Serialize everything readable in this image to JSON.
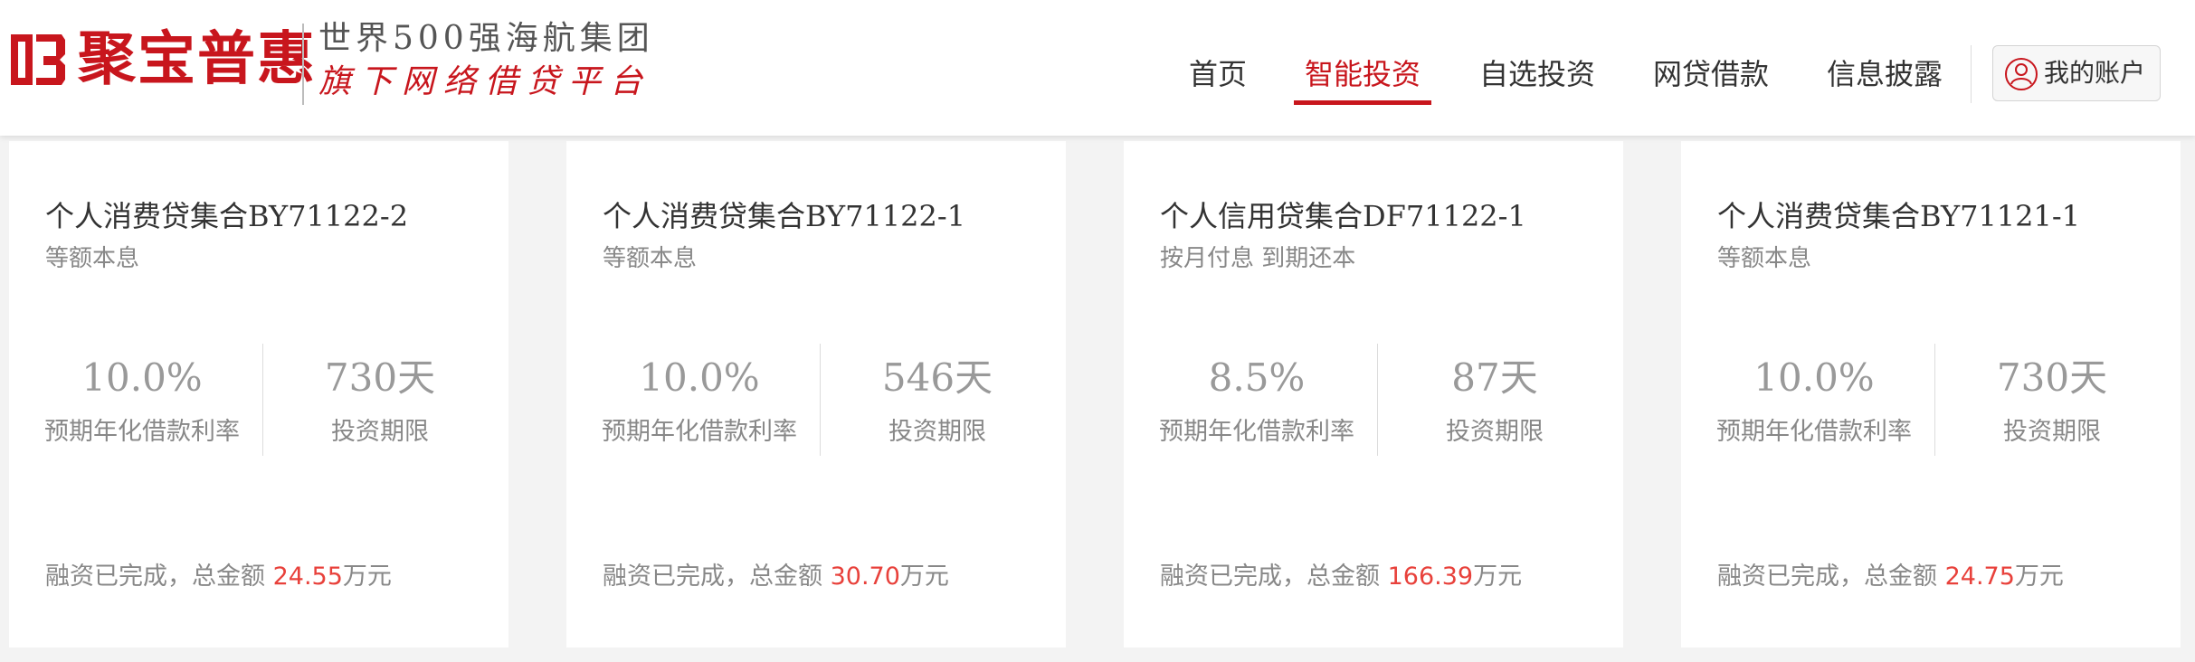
{
  "brand": {
    "name": "聚宝普惠",
    "slogan_line1": "世界500强海航集团",
    "slogan_line2": "旗下网络借贷平台",
    "color": "#c8161d"
  },
  "nav": {
    "items": [
      {
        "label": "首页"
      },
      {
        "label": "智能投资",
        "active": true
      },
      {
        "label": "自选投资"
      },
      {
        "label": "网贷借款"
      },
      {
        "label": "信息披露"
      }
    ],
    "account": {
      "label": "我的账户",
      "icon": "user-icon"
    }
  },
  "cards": [
    {
      "title": "个人消费贷集合BY71122-2",
      "repayment": "等额本息",
      "rate": "10.0%",
      "rate_label": "预期年化借款利率",
      "term": "730天",
      "term_label": "投资期限",
      "footer_prefix": "融资已完成，总金额 ",
      "amount": "24.55",
      "unit": "万元"
    },
    {
      "title": "个人消费贷集合BY71122-1",
      "repayment": "等额本息",
      "rate": "10.0%",
      "rate_label": "预期年化借款利率",
      "term": "546天",
      "term_label": "投资期限",
      "footer_prefix": "融资已完成，总金额 ",
      "amount": "30.70",
      "unit": "万元"
    },
    {
      "title": "个人信用贷集合DF71122-1",
      "repayment": "按月付息 到期还本",
      "rate": "8.5%",
      "rate_label": "预期年化借款利率",
      "term": "87天",
      "term_label": "投资期限",
      "footer_prefix": "融资已完成，总金额 ",
      "amount": "166.39",
      "unit": "万元"
    },
    {
      "title": "个人消费贷集合BY71121-1",
      "repayment": "等额本息",
      "rate": "10.0%",
      "rate_label": "预期年化借款利率",
      "term": "730天",
      "term_label": "投资期限",
      "footer_prefix": "融资已完成，总金额 ",
      "amount": "24.75",
      "unit": "万元"
    }
  ],
  "colors": {
    "accent": "#c8161d",
    "amount": "#e8413b",
    "muted_text": "#888888",
    "page_bg": "#f3f3f3"
  }
}
